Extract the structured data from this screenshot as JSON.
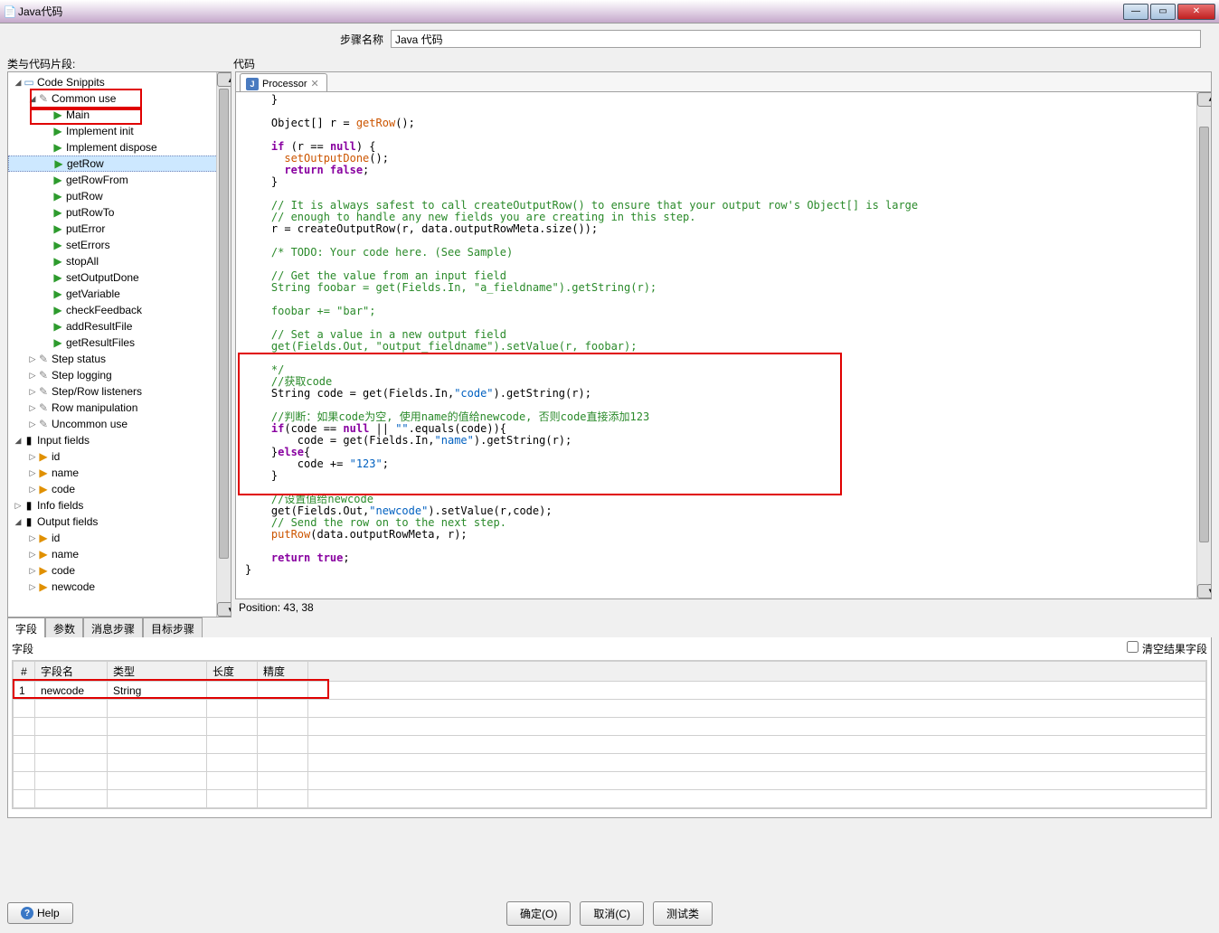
{
  "window": {
    "title": "Java代码"
  },
  "stepname": {
    "label": "步骤名称",
    "value": "Java 代码"
  },
  "panes": {
    "tree_header": "类与代码片段:",
    "code_header": "代码"
  },
  "tree": {
    "root": "Code Snippits",
    "common": "Common use",
    "items": [
      "Main",
      "Implement init",
      "Implement dispose",
      "getRow",
      "getRowFrom",
      "putRow",
      "putRowTo",
      "putError",
      "setErrors",
      "stopAll",
      "setOutputDone",
      "getVariable",
      "checkFeedback",
      "addResultFile",
      "getResultFiles"
    ],
    "groups": [
      "Step status",
      "Step logging",
      "Step/Row listeners",
      "Row manipulation",
      "Uncommon use"
    ],
    "input_fields_label": "Input fields",
    "input_fields": [
      "id",
      "name",
      "code"
    ],
    "info_fields_label": "Info fields",
    "output_fields_label": "Output fields",
    "output_fields": [
      "id",
      "name",
      "code",
      "newcode"
    ]
  },
  "editor": {
    "tab": "Processor",
    "position": "Position: 43, 38",
    "l1": "    }",
    "l2": "    Object[] r = ",
    "l2b": "getRow",
    "l2c": "();",
    "l3a": "    if",
    "l3b": " (r == ",
    "l3c": "null",
    "l3d": ") {",
    "l4": "      setOutputDone",
    "l4b": "();",
    "l5a": "      return ",
    "l5b": "false",
    "l5c": ";",
    "l6": "    }",
    "c1": "    // It is always safest to call createOutputRow() to ensure that your output row's Object[] is large",
    "c2": "    // enough to handle any new fields you are creating in this step.",
    "l7": "    r = createOutputRow(r, data.outputRowMeta.size());",
    "c3": "    /* TODO: Your code here. (See Sample)",
    "c4": "    // Get the value from an input field",
    "l8": "    String foobar = get(Fields.In, \"a_fieldname\").getString(r);",
    "l9": "    foobar += \"bar\";",
    "c5": "    // Set a value in a new output field",
    "l10": "    get(Fields.Out, \"output_fieldname\").setValue(r, foobar);",
    "l10b": "    */",
    "c6": "    //获取code",
    "l11a": "    String code = get(Fields.In,",
    "l11b": "\"code\"",
    "l11c": ").getString(r);",
    "c7": "    //判断：如果code为空, 使用name的值给newcode, 否则code直接添加123",
    "l12a": "    if",
    "l12b": "(code == ",
    "l12c": "null",
    "l12d": " || ",
    "l12e": "\"\"",
    "l12f": ".equals(code)){",
    "l13a": "        code = get(Fields.In,",
    "l13b": "\"name\"",
    "l13c": ").getString(r);",
    "l14a": "    }",
    "l14b": "else",
    "l14c": "{",
    "l15a": "        code += ",
    "l15b": "\"123\"",
    "l15c": ";",
    "l16": "    }",
    "c8": "    //设置值给newcode",
    "l17a": "    get(Fields.Out,",
    "l17b": "\"newcode\"",
    "l17c": ").setValue(r,code);",
    "c9": "    // Send the row on to the next step.",
    "l18a": "    putRow",
    "l18b": "(data.outputRowMeta, r);",
    "l19a": "    return ",
    "l19b": "true",
    "l19c": ";",
    "l20": "}"
  },
  "tabs2": [
    "字段",
    "参数",
    "消息步骤",
    "目标步骤"
  ],
  "fields": {
    "label": "字段",
    "clear": "清空结果字段",
    "cols": {
      "num": "#",
      "name": "字段名",
      "type": "类型",
      "len": "长度",
      "prec": "精度"
    },
    "row": {
      "num": "1",
      "name": "newcode",
      "type": "String",
      "len": "",
      "prec": ""
    }
  },
  "buttons": {
    "help": "Help",
    "ok": "确定(O)",
    "cancel": "取消(C)",
    "test": "测试类"
  }
}
